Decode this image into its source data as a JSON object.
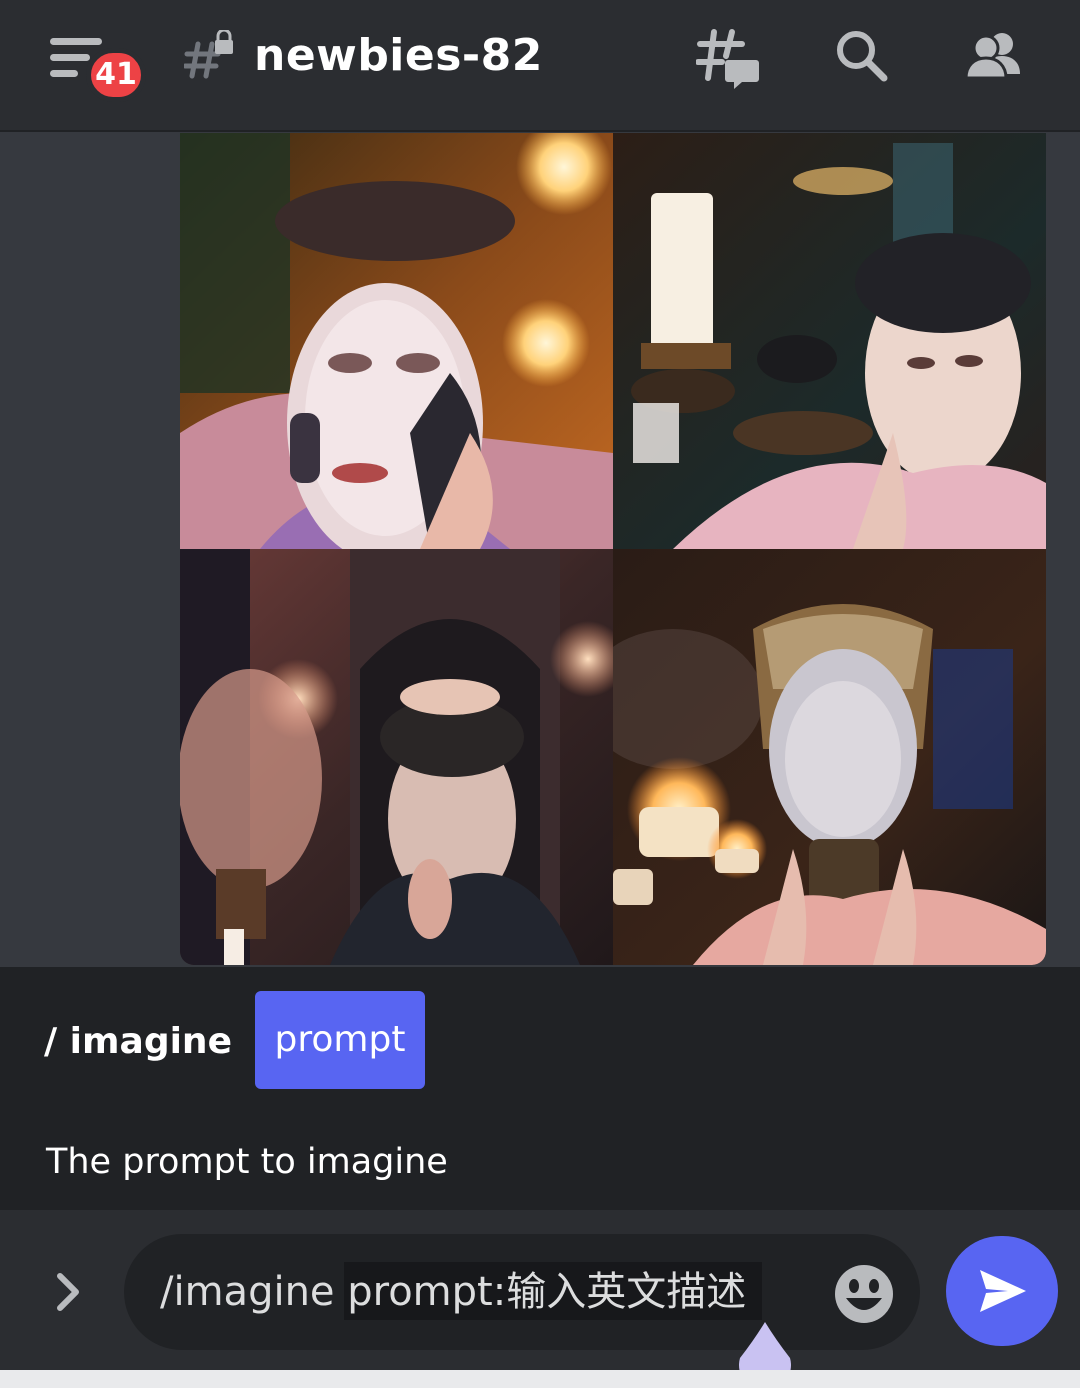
{
  "header": {
    "unread_count": "41",
    "channel_name": "newbies-82",
    "icons": [
      "menu-icon",
      "locked-channel-hash-icon",
      "threads-icon",
      "search-icon",
      "members-icon"
    ]
  },
  "image_grid": {
    "tiles": [
      "masked-face-amber-lights",
      "face-mask-candle-vanity",
      "ornate-face-mask-arched-room",
      "golden-mask-candles"
    ]
  },
  "command": {
    "name": "/ imagine",
    "option": "prompt",
    "option_description": "The prompt to imagine"
  },
  "composer": {
    "text": "/imagine prompt:输入英文描述",
    "icons": [
      "chevron-right-icon",
      "emoji-icon",
      "send-icon"
    ]
  },
  "colors": {
    "background": "#36393f",
    "header": "#2b2d31",
    "panel": "#202225",
    "accent": "#5865f2",
    "badge": "#ed4245"
  }
}
